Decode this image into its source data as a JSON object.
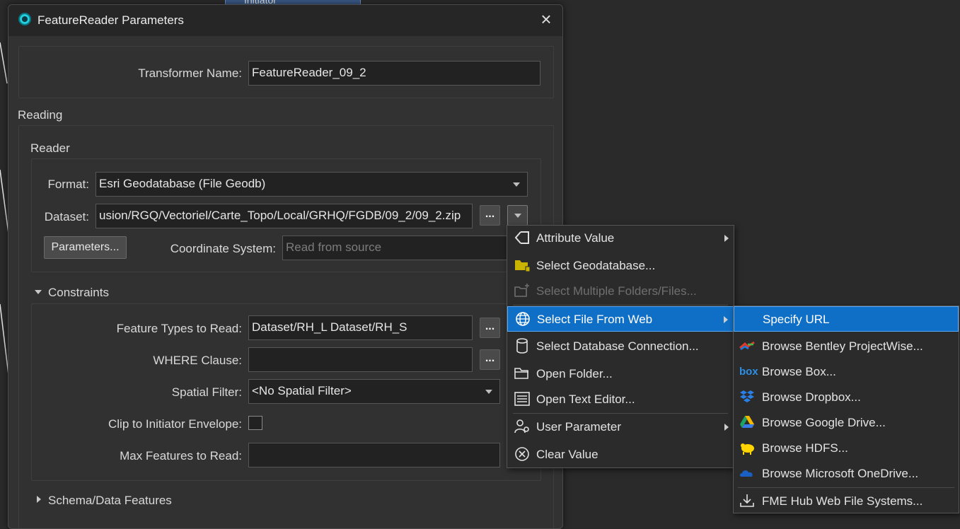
{
  "canvas": {
    "node_label": "Initiator"
  },
  "dialog": {
    "title": "FeatureReader Parameters",
    "transformer_name_label": "Transformer Name:",
    "transformer_name_value": "FeatureReader_09_2",
    "reading_label": "Reading",
    "reader_label": "Reader",
    "format_label": "Format:",
    "format_value": "Esri Geodatabase (File Geodb)",
    "dataset_label": "Dataset:",
    "dataset_value": "usion/RGQ/Vectoriel/Carte_Topo/Local/GRHQ/FGDB/09_2/09_2.zip",
    "ellipsis_label": "...",
    "parameters_button": "Parameters...",
    "coord_system_label": "Coordinate System:",
    "coord_system_placeholder": "Read from source",
    "constraints_label": "Constraints",
    "feature_types_label": "Feature Types to Read:",
    "feature_types_value": "Dataset/RH_L Dataset/RH_S",
    "where_label": "WHERE Clause:",
    "where_value": "",
    "spatial_filter_label": "Spatial Filter:",
    "spatial_filter_value": "<No Spatial Filter>",
    "clip_label": "Clip to Initiator Envelope:",
    "max_features_label": "Max Features to Read:",
    "max_features_value": "",
    "schema_label": "Schema/Data Features"
  },
  "menu": {
    "items": [
      {
        "label": "Attribute Value",
        "icon": "attribute-value-icon"
      },
      {
        "label": "Select Geodatabase...",
        "icon": "geodatabase-folder-icon"
      },
      {
        "label": "Select Multiple Folders/Files...",
        "icon": "multi-folder-icon"
      },
      {
        "label": "Select File From Web",
        "icon": "globe-icon"
      },
      {
        "label": "Select Database Connection...",
        "icon": "database-icon"
      },
      {
        "label": "Open Folder...",
        "icon": "folder-icon"
      },
      {
        "label": "Open Text Editor...",
        "icon": "text-editor-icon"
      },
      {
        "label": "User Parameter",
        "icon": "user-parameter-icon"
      },
      {
        "label": "Clear Value",
        "icon": "clear-icon"
      }
    ]
  },
  "submenu": {
    "items": [
      {
        "label": "Specify URL"
      },
      {
        "label": "Browse Bentley ProjectWise...",
        "icon": "projectwise-icon"
      },
      {
        "label": "Browse Box...",
        "icon": "box-icon",
        "icon_text": "box"
      },
      {
        "label": "Browse Dropbox...",
        "icon": "dropbox-icon"
      },
      {
        "label": "Browse Google Drive...",
        "icon": "google-drive-icon"
      },
      {
        "label": "Browse HDFS...",
        "icon": "hdfs-icon"
      },
      {
        "label": "Browse Microsoft OneDrive...",
        "icon": "onedrive-icon"
      },
      {
        "label": "FME Hub Web File Systems...",
        "icon": "download-icon"
      }
    ]
  },
  "colors": {
    "highlight": "#0f6fc6",
    "background": "#323232"
  }
}
